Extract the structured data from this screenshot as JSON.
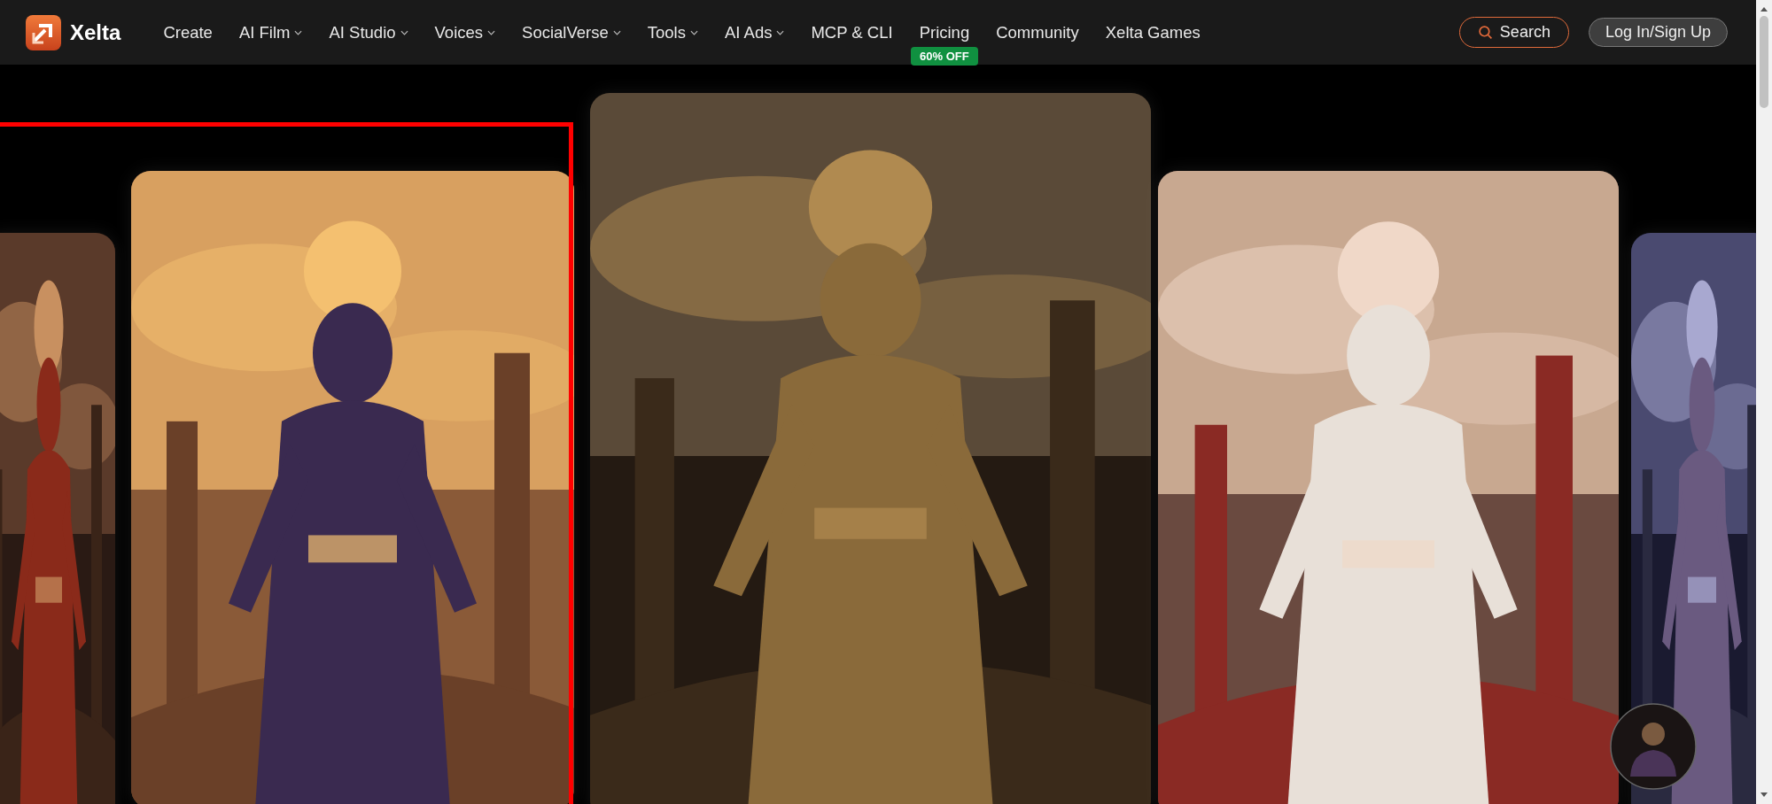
{
  "brand": {
    "name": "Xelta"
  },
  "nav": [
    {
      "label": "Create",
      "has_dropdown": false
    },
    {
      "label": "AI Film",
      "has_dropdown": true
    },
    {
      "label": "AI Studio",
      "has_dropdown": true
    },
    {
      "label": "Voices",
      "has_dropdown": true
    },
    {
      "label": "SocialVerse",
      "has_dropdown": true
    },
    {
      "label": "Tools",
      "has_dropdown": true
    },
    {
      "label": "AI Ads",
      "has_dropdown": true
    },
    {
      "label": "MCP & CLI",
      "has_dropdown": false
    },
    {
      "label": "Pricing",
      "has_dropdown": false,
      "badge": "60% OFF"
    },
    {
      "label": "Community",
      "has_dropdown": false
    },
    {
      "label": "Xelta Games",
      "has_dropdown": false
    }
  ],
  "search": {
    "label": "Search"
  },
  "login": {
    "label": "Log In/Sign Up"
  },
  "carousel": [
    {
      "kind": "picture",
      "highlighted": false
    },
    {
      "kind": "picture",
      "highlighted": true
    },
    {
      "kind": "picture",
      "highlighted": false
    },
    {
      "kind": "picture",
      "highlighted": false
    },
    {
      "kind": "picture",
      "highlighted": false
    }
  ]
}
